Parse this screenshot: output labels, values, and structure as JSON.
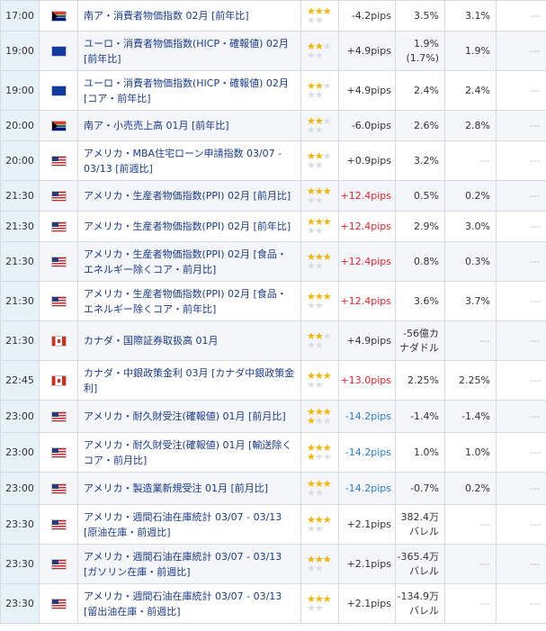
{
  "rows": [
    {
      "time": "17:00",
      "flag": "za",
      "event": "南ア・消費者物価指数 02月 [前年比]",
      "stars": 3,
      "pips": "-4.2pips",
      "pips_color": "",
      "prev": [
        "3.5%"
      ],
      "forecast": [
        "3.1%"
      ],
      "result": [
        "---"
      ]
    },
    {
      "time": "19:00",
      "flag": "eu",
      "event": "ユーロ・消費者物価指数(HICP・確報値) 02月 [前年比]",
      "stars": 2,
      "pips": "+4.9pips",
      "pips_color": "",
      "prev": [
        "1.9%",
        "(1.7%)"
      ],
      "forecast": [
        "1.9%"
      ],
      "result": [
        "---"
      ]
    },
    {
      "time": "19:00",
      "flag": "eu",
      "event": "ユーロ・消費者物価指数(HICP・確報値) 02月 [コア・前年比]",
      "stars": 2,
      "pips": "+4.9pips",
      "pips_color": "",
      "prev": [
        "2.4%"
      ],
      "forecast": [
        "2.4%"
      ],
      "result": [
        "---"
      ]
    },
    {
      "time": "20:00",
      "flag": "za",
      "event": "南ア・小売売上高 01月 [前年比]",
      "stars": 2,
      "pips": "-6.0pips",
      "pips_color": "",
      "prev": [
        "2.6%"
      ],
      "forecast": [
        "2.8%"
      ],
      "result": [
        "---"
      ]
    },
    {
      "time": "20:00",
      "flag": "us",
      "event": "アメリカ・MBA住宅ローン申請指数 03/07 - 03/13 [前週比]",
      "stars": 2,
      "pips": "+0.9pips",
      "pips_color": "",
      "prev": [
        "3.2%"
      ],
      "forecast": [
        "---"
      ],
      "result": [
        "---"
      ]
    },
    {
      "time": "21:30",
      "flag": "us",
      "event": "アメリカ・生産者物価指数(PPI) 02月 [前月比]",
      "stars": 3,
      "pips": "+12.4pips",
      "pips_color": "red",
      "prev": [
        "0.5%"
      ],
      "forecast": [
        "0.2%"
      ],
      "result": [
        "---"
      ]
    },
    {
      "time": "21:30",
      "flag": "us",
      "event": "アメリカ・生産者物価指数(PPI) 02月 [前年比]",
      "stars": 3,
      "pips": "+12.4pips",
      "pips_color": "red",
      "prev": [
        "2.9%"
      ],
      "forecast": [
        "3.0%"
      ],
      "result": [
        "---"
      ]
    },
    {
      "time": "21:30",
      "flag": "us",
      "event": "アメリカ・生産者物価指数(PPI) 02月 [食品・エネルギー除くコア・前月比]",
      "stars": 3,
      "pips": "+12.4pips",
      "pips_color": "red",
      "prev": [
        "0.8%"
      ],
      "forecast": [
        "0.3%"
      ],
      "result": [
        "---"
      ]
    },
    {
      "time": "21:30",
      "flag": "us",
      "event": "アメリカ・生産者物価指数(PPI) 02月 [食品・エネルギー除くコア・前年比]",
      "stars": 3,
      "pips": "+12.4pips",
      "pips_color": "red",
      "prev": [
        "3.6%"
      ],
      "forecast": [
        "3.7%"
      ],
      "result": [
        "---"
      ]
    },
    {
      "time": "21:30",
      "flag": "ca",
      "event": "カナダ・国際証券取扱高 01月",
      "stars": 2,
      "pips": "+4.9pips",
      "pips_color": "",
      "prev": [
        "-56億カ",
        "ナダドル"
      ],
      "forecast": [
        "---"
      ],
      "result": [
        "---"
      ]
    },
    {
      "time": "22:45",
      "flag": "ca",
      "event": "カナダ・中銀政策金利 03月 [カナダ中銀政策金利]",
      "stars": 3,
      "pips": "+13.0pips",
      "pips_color": "red",
      "prev": [
        "2.25%"
      ],
      "forecast": [
        "2.25%"
      ],
      "result": [
        "---"
      ]
    },
    {
      "time": "23:00",
      "flag": "us",
      "event": "アメリカ・耐久財受注(確報値) 01月 [前月比]",
      "stars": 4,
      "pips": "-14.2pips",
      "pips_color": "blue",
      "prev": [
        "-1.4%"
      ],
      "forecast": [
        "-1.4%"
      ],
      "result": [
        "---"
      ]
    },
    {
      "time": "23:00",
      "flag": "us",
      "event": "アメリカ・耐久財受注(確報値) 01月 [輸送除くコア・前月比]",
      "stars": 4,
      "pips": "-14.2pips",
      "pips_color": "blue",
      "prev": [
        "1.0%"
      ],
      "forecast": [
        "1.0%"
      ],
      "result": [
        "---"
      ]
    },
    {
      "time": "23:00",
      "flag": "us",
      "event": "アメリカ・製造業新規受注 01月 [前月比]",
      "stars": 3,
      "pips": "-14.2pips",
      "pips_color": "blue",
      "prev": [
        "-0.7%"
      ],
      "forecast": [
        "0.2%"
      ],
      "result": [
        "---"
      ]
    },
    {
      "time": "23:30",
      "flag": "us",
      "event": "アメリカ・週間石油在庫統計 03/07 - 03/13 [原油在庫・前週比]",
      "stars": 3,
      "pips": "+2.1pips",
      "pips_color": "",
      "prev": [
        "382.4万",
        "バレル"
      ],
      "forecast": [
        "---"
      ],
      "result": [
        "---"
      ]
    },
    {
      "time": "23:30",
      "flag": "us",
      "event": "アメリカ・週間石油在庫統計 03/07 - 03/13 [ガソリン在庫・前週比]",
      "stars": 3,
      "pips": "+2.1pips",
      "pips_color": "",
      "prev": [
        "-365.4万",
        "バレル"
      ],
      "forecast": [
        "---"
      ],
      "result": [
        "---"
      ]
    },
    {
      "time": "23:30",
      "flag": "us",
      "event": "アメリカ・週間石油在庫統計 03/07 - 03/13 [留出油在庫・前週比]",
      "stars": 3,
      "pips": "+2.1pips",
      "pips_color": "",
      "prev": [
        "-134.9万",
        "バレル"
      ],
      "forecast": [
        "---"
      ],
      "result": [
        "---"
      ]
    }
  ]
}
